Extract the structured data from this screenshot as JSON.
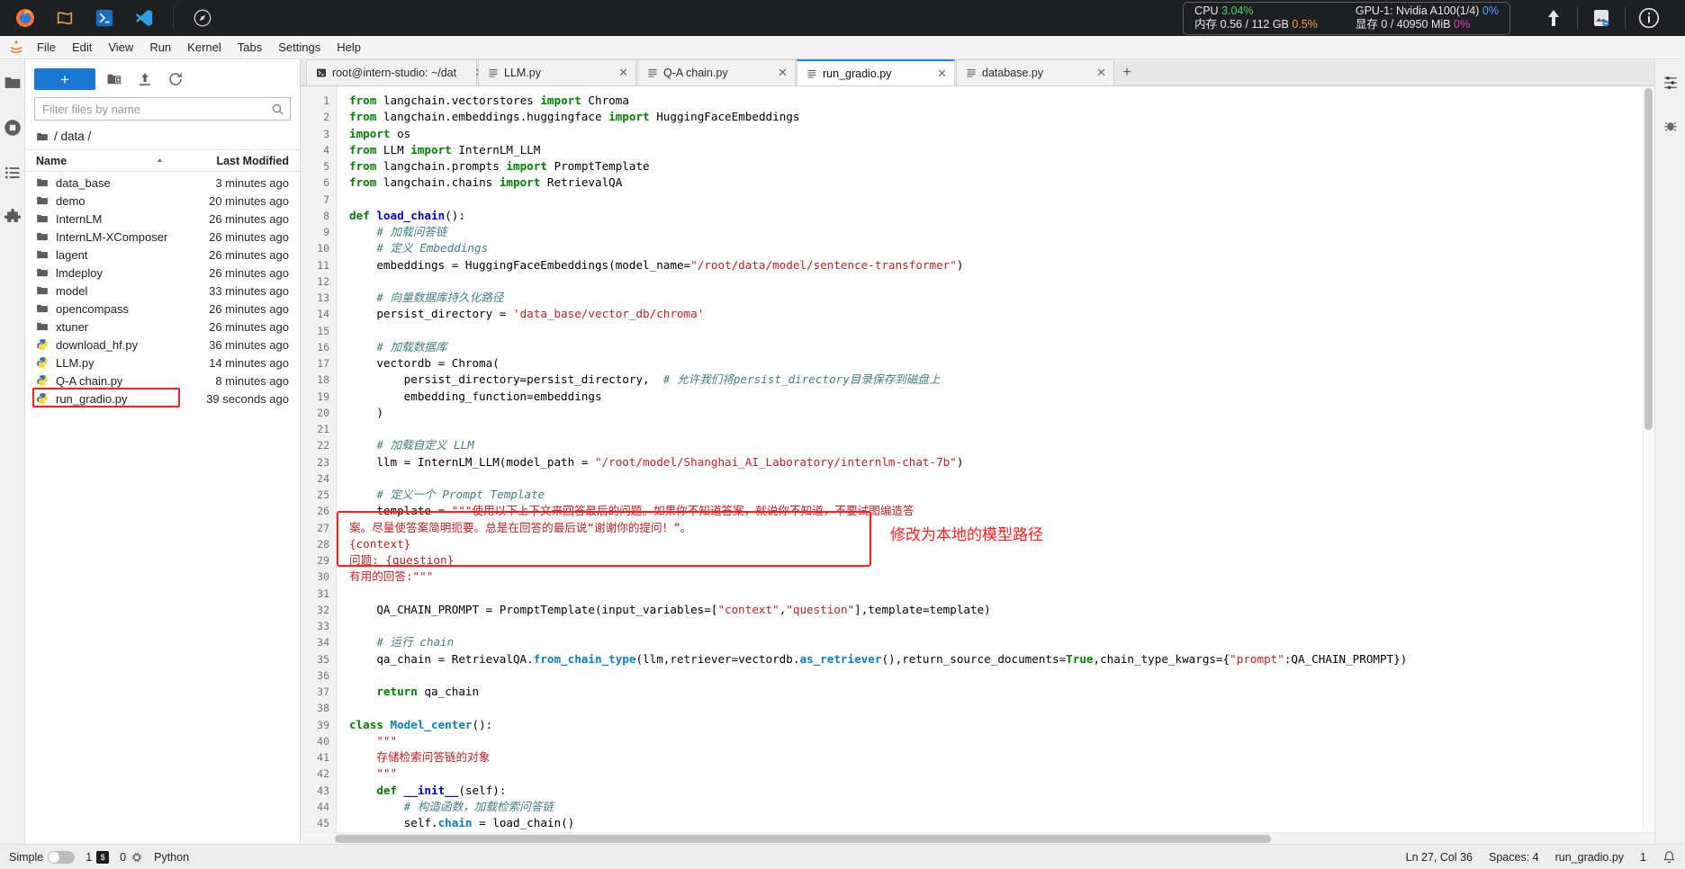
{
  "system_bar": {
    "apps": [
      "firefox-icon",
      "terminal-icon",
      "vscode-alt-icon",
      "vscode-icon",
      "compass-icon"
    ],
    "metrics": {
      "cpu_label": "CPU",
      "cpu_value": "3.04%",
      "mem_label": "内存",
      "mem_value": "0.56 / 112 GB",
      "mem_pct": "0.5%",
      "gpu_label": "GPU-1: Nvidia A100(1/4)",
      "gpu_value": "0%",
      "vram_label": "显存",
      "vram_value": "0 / 40950 MiB",
      "vram_pct": "0%"
    },
    "icons": [
      "upload-arrow-icon",
      "image-icon",
      "info-icon"
    ]
  },
  "menubar": {
    "items": [
      "File",
      "Edit",
      "View",
      "Run",
      "Kernel",
      "Tabs",
      "Settings",
      "Help"
    ]
  },
  "left_rail": {
    "items": [
      "folder-icon",
      "running-terminals-icon",
      "commands-icon",
      "extensions-icon"
    ]
  },
  "filebrowser": {
    "new_launcher_label": "+",
    "toolbar_icons": [
      "new-folder-icon",
      "upload-icon",
      "refresh-icon"
    ],
    "filter_placeholder": "Filter files by name",
    "filter_value": "",
    "breadcrumb": "/ data /",
    "columns": {
      "name": "Name",
      "modified": "Last Modified"
    },
    "rows": [
      {
        "name": "data_base",
        "modified": "3 minutes ago",
        "kind": "folder",
        "selected": false
      },
      {
        "name": "demo",
        "modified": "20 minutes ago",
        "kind": "folder",
        "selected": false
      },
      {
        "name": "InternLM",
        "modified": "26 minutes ago",
        "kind": "folder",
        "selected": false
      },
      {
        "name": "InternLM-XComposer",
        "modified": "26 minutes ago",
        "kind": "folder",
        "selected": false
      },
      {
        "name": "lagent",
        "modified": "26 minutes ago",
        "kind": "folder",
        "selected": false
      },
      {
        "name": "lmdeploy",
        "modified": "26 minutes ago",
        "kind": "folder",
        "selected": false
      },
      {
        "name": "model",
        "modified": "33 minutes ago",
        "kind": "folder",
        "selected": false
      },
      {
        "name": "opencompass",
        "modified": "26 minutes ago",
        "kind": "folder",
        "selected": false
      },
      {
        "name": "xtuner",
        "modified": "26 minutes ago",
        "kind": "folder",
        "selected": false
      },
      {
        "name": "download_hf.py",
        "modified": "36 minutes ago",
        "kind": "python",
        "selected": false
      },
      {
        "name": "LLM.py",
        "modified": "14 minutes ago",
        "kind": "python",
        "selected": false
      },
      {
        "name": "Q-A chain.py",
        "modified": "8 minutes ago",
        "kind": "python",
        "selected": false
      },
      {
        "name": "run_gradio.py",
        "modified": "39 seconds ago",
        "kind": "python",
        "selected": true
      }
    ]
  },
  "tabs": [
    {
      "label": "root@intern-studio: ~/dat",
      "icon": "terminal-icon",
      "active": false,
      "close": "✕"
    },
    {
      "label": "LLM.py",
      "icon": "file-text-icon",
      "active": false,
      "close": "✕"
    },
    {
      "label": "Q-A chain.py",
      "icon": "file-text-icon",
      "active": false,
      "close": "✕"
    },
    {
      "label": "run_gradio.py",
      "icon": "file-text-icon",
      "active": true,
      "close": "✕"
    },
    {
      "label": "database.py",
      "icon": "file-text-icon",
      "active": false,
      "close": "✕"
    }
  ],
  "tab_add_label": "+",
  "editor": {
    "line_numbers": [
      "1",
      "2",
      "3",
      "4",
      "5",
      "6",
      "7",
      "8",
      "9",
      "10",
      "11",
      "12",
      "13",
      "14",
      "15",
      "16",
      "17",
      "18",
      "19",
      "20",
      "21",
      "22",
      "23",
      "24",
      "25",
      "26",
      "27",
      "28",
      "29",
      "30",
      "31",
      "32",
      "33",
      "34",
      "35",
      "36",
      "37",
      "38",
      "39",
      "40",
      "41",
      "42",
      "43",
      "44",
      "45"
    ],
    "annotation": "修改为本地的模型路径",
    "annotation_color": "#ff1d1d",
    "highlight_color": "#ff1d1d"
  },
  "statusbar": {
    "mode_label": "Simple",
    "terminals_count": "1",
    "kernel_badge": "$",
    "kernels_count": "0",
    "kernel_icon": "kernel-icon",
    "language": "Python",
    "cursor_position": "Ln 27, Col 36",
    "spaces": "Spaces: 4",
    "filename": "run_gradio.py",
    "notifications_count": "1",
    "bell_icon": "bell-icon"
  }
}
